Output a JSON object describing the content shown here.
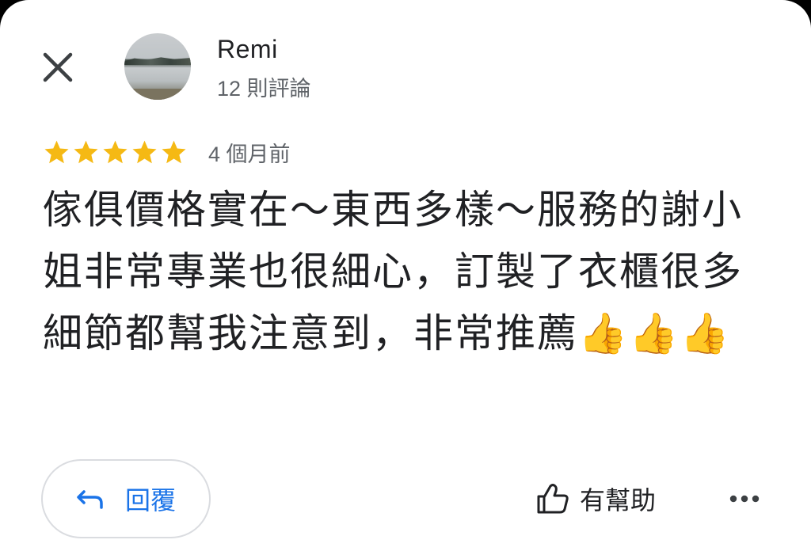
{
  "review": {
    "author_name": "Remi",
    "author_review_count": "12 則評論",
    "rating": 5,
    "rating_max": 5,
    "time_ago": "4 個月前",
    "text": "傢俱價格實在～東西多樣～服務的謝小姐非常專業也很細心，訂製了衣櫃很多細節都幫我注意到，非常推薦👍👍👍"
  },
  "actions": {
    "reply_label": "回覆",
    "helpful_label": "有幫助"
  },
  "icons": {
    "close": "close-icon",
    "reply": "reply-arrow-icon",
    "helpful": "thumbs-up-icon",
    "more": "more-horizontal-icon",
    "star": "star-icon"
  },
  "colors": {
    "star": "#f5b914",
    "accent": "#1a73e8",
    "text_primary": "#202124",
    "text_secondary": "#5f6368",
    "border": "#dadce0"
  }
}
